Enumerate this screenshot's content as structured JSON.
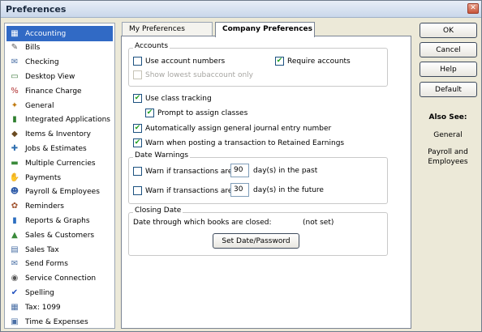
{
  "window": {
    "title": "Preferences",
    "close_glyph": "✕"
  },
  "sidebar": {
    "items": [
      {
        "label": "Accounting",
        "icon": "accounting-icon",
        "glyph": "▦",
        "color": "#2d5aa8"
      },
      {
        "label": "Bills",
        "icon": "bills-icon",
        "glyph": "✎",
        "color": "#5a5a5a"
      },
      {
        "label": "Checking",
        "icon": "checking-icon",
        "glyph": "✉",
        "color": "#4a6fa5"
      },
      {
        "label": "Desktop View",
        "icon": "desktop-view-icon",
        "glyph": "▭",
        "color": "#3d7a3d"
      },
      {
        "label": "Finance Charge",
        "icon": "finance-charge-icon",
        "glyph": "%",
        "color": "#b03030"
      },
      {
        "label": "General",
        "icon": "general-icon",
        "glyph": "✦",
        "color": "#c07a10"
      },
      {
        "label": "Integrated Applications",
        "icon": "integrated-applications-icon",
        "glyph": "▮",
        "color": "#2f7f2f"
      },
      {
        "label": "Items & Inventory",
        "icon": "items-inventory-icon",
        "glyph": "◆",
        "color": "#6a4a20"
      },
      {
        "label": "Jobs & Estimates",
        "icon": "jobs-estimates-icon",
        "glyph": "✚",
        "color": "#2f6fb0"
      },
      {
        "label": "Multiple Currencies",
        "icon": "multiple-currencies-icon",
        "glyph": "▬",
        "color": "#3a8a3a"
      },
      {
        "label": "Payments",
        "icon": "payments-icon",
        "glyph": "✋",
        "color": "#b07a20"
      },
      {
        "label": "Payroll & Employees",
        "icon": "payroll-employees-icon",
        "glyph": "☻",
        "color": "#2d5aa8"
      },
      {
        "label": "Reminders",
        "icon": "reminders-icon",
        "glyph": "✿",
        "color": "#a0522d"
      },
      {
        "label": "Reports & Graphs",
        "icon": "reports-graphs-icon",
        "glyph": "▮",
        "color": "#2c6ec0"
      },
      {
        "label": "Sales & Customers",
        "icon": "sales-customers-icon",
        "glyph": "▲",
        "color": "#3a8a3a"
      },
      {
        "label": "Sales Tax",
        "icon": "sales-tax-icon",
        "glyph": "▤",
        "color": "#4a6fa5"
      },
      {
        "label": "Send Forms",
        "icon": "send-forms-icon",
        "glyph": "✉",
        "color": "#4a6fa5"
      },
      {
        "label": "Service Connection",
        "icon": "service-connection-icon",
        "glyph": "◉",
        "color": "#555555"
      },
      {
        "label": "Spelling",
        "icon": "spelling-icon",
        "glyph": "✔",
        "color": "#1f4fbf"
      },
      {
        "label": "Tax: 1099",
        "icon": "tax-1099-icon",
        "glyph": "▦",
        "color": "#4a6fa5"
      },
      {
        "label": "Time & Expenses",
        "icon": "time-expenses-icon",
        "glyph": "▣",
        "color": "#4a6fa5"
      }
    ]
  },
  "tabs": [
    {
      "label": "My Preferences",
      "active": false
    },
    {
      "label": "Company Preferences",
      "active": true
    }
  ],
  "accounts_group": {
    "label": "Accounts",
    "use_account_numbers": {
      "label": "Use account numbers",
      "checked": false
    },
    "require_accounts": {
      "label": "Require accounts",
      "checked": true
    },
    "show_lowest_subaccount": {
      "label": "Show lowest subaccount only",
      "checked": false,
      "disabled": true
    }
  },
  "class_tracking": {
    "label": "Use class tracking",
    "checked": true
  },
  "prompt_assign_classes": {
    "label": "Prompt to assign classes",
    "checked": true
  },
  "auto_assign_journal": {
    "label": "Automatically assign general journal entry number",
    "checked": true
  },
  "warn_retained_earnings": {
    "label": "Warn when posting a transaction to Retained Earnings",
    "checked": true
  },
  "date_warnings": {
    "label": "Date Warnings",
    "past": {
      "prefix": "Warn if transactions are",
      "value": "90",
      "suffix": "day(s) in the past",
      "checked": false
    },
    "future": {
      "prefix": "Warn if transactions are",
      "value": "30",
      "suffix": "day(s) in the future",
      "checked": false
    }
  },
  "closing_date": {
    "label": "Closing Date",
    "text": "Date through which books are closed:",
    "value": "(not set)",
    "button": "Set Date/Password"
  },
  "buttons": {
    "ok": "OK",
    "cancel": "Cancel",
    "help": "Help",
    "default": "Default"
  },
  "also_see": {
    "title": "Also See:",
    "links": [
      "General",
      "Payroll and Employees"
    ]
  },
  "colors": {
    "selection": "#316ac5",
    "check": "#21a121"
  },
  "check_glyph": "✔"
}
